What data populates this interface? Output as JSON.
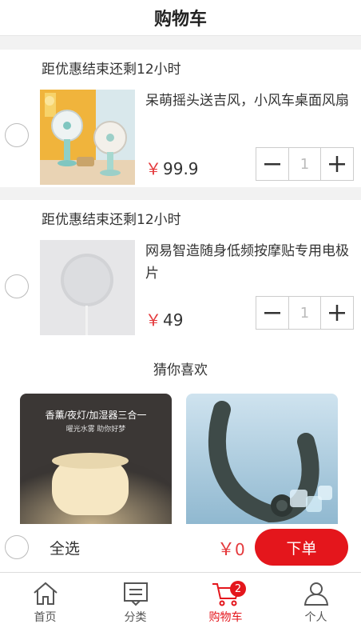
{
  "header": {
    "title": "购物车"
  },
  "cart_items": [
    {
      "deadline": "距优惠结束还剩12小时",
      "name": "呆萌摇头送吉风，小风车桌面风扇",
      "currency": "￥",
      "price": "99.9",
      "quantity": "1"
    },
    {
      "deadline": "距优惠结束还剩12小时",
      "name": "网易智造随身低频按摩贴专用电极片",
      "currency": "￥",
      "price": "49",
      "quantity": "1"
    }
  ],
  "recommend": {
    "title": "猜你喜欢",
    "products": [
      {
        "overlay_title": "香薰/夜灯/加湿器三合一",
        "overlay_subtitle": "曜光水雾 助你好梦"
      },
      {
        "overlay_title": ""
      }
    ]
  },
  "checkout": {
    "select_all": "全选",
    "currency": "￥",
    "total": "0",
    "order_button": "下单"
  },
  "tabbar": {
    "tabs": [
      {
        "label": "首页",
        "icon": "home-icon"
      },
      {
        "label": "分类",
        "icon": "category-icon"
      },
      {
        "label": "购物车",
        "icon": "cart-icon",
        "badge": "2",
        "active": true
      },
      {
        "label": "个人",
        "icon": "user-icon"
      }
    ]
  },
  "colors": {
    "accent": "#e4161c",
    "price": "#e4393c"
  }
}
